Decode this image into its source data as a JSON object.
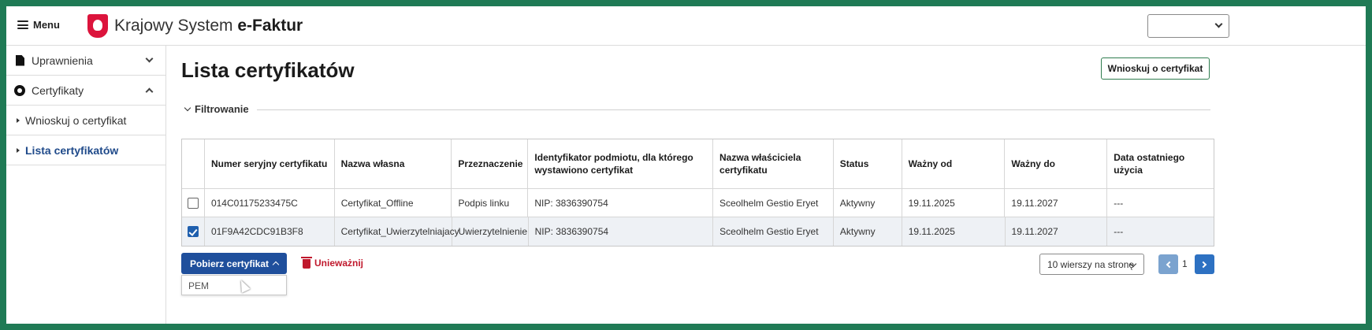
{
  "header": {
    "menu_label": "Menu",
    "brand_prefix": "Krajowy System ",
    "brand_bold": "e-Faktur",
    "top_select_value": ""
  },
  "sidebar": {
    "groups": [
      {
        "label": "Uprawnienia",
        "icon": "document-icon",
        "expanded": false
      },
      {
        "label": "Certyfikaty",
        "icon": "certificate-icon",
        "expanded": true
      }
    ],
    "sub_items": [
      {
        "label": "Wnioskuj o certyfikat",
        "active": false
      },
      {
        "label": "Lista certyfikatów",
        "active": true
      }
    ]
  },
  "main": {
    "title": "Lista certyfikatów",
    "request_button": "Wnioskuj o certyfikat",
    "filter_label": "Filtrowanie"
  },
  "table": {
    "columns": [
      "Numer seryjny certyfikatu",
      "Nazwa własna",
      "Przeznaczenie",
      "Identyfikator podmiotu, dla którego wystawiono certyfikat",
      "Nazwa właściciela certyfikatu",
      "Status",
      "Ważny od",
      "Ważny do",
      "Data ostatniego użycia"
    ],
    "rows": [
      {
        "checked": false,
        "cells": [
          "014C01175233475C",
          "Certyfikat_Offline",
          "Podpis linku",
          "NIP: 3836390754",
          "Sceolhelm Gestio Eryet",
          "Aktywny",
          "19.11.2025",
          "19.11.2027",
          "---"
        ]
      },
      {
        "checked": true,
        "cells": [
          "01F9A42CDC91B3F8",
          "Certyfikat_Uwierzytelniajacy",
          "Uwierzytelnienie",
          "NIP: 3836390754",
          "Sceolhelm Gestio Eryet",
          "Aktywny",
          "19.11.2025",
          "19.11.2027",
          "---"
        ]
      }
    ]
  },
  "actions": {
    "download_button": "Pobierz certyfikat",
    "revoke_button": "Unieważnij",
    "dropdown_items": [
      "PEM"
    ]
  },
  "pagination": {
    "rows_per_page": "10 wierszy na stronę",
    "current_page": "1"
  },
  "colors": {
    "frame": "#1f7a55",
    "primary": "#1f4f9c",
    "danger": "#c0192d",
    "active_link": "#1f4a8a"
  }
}
